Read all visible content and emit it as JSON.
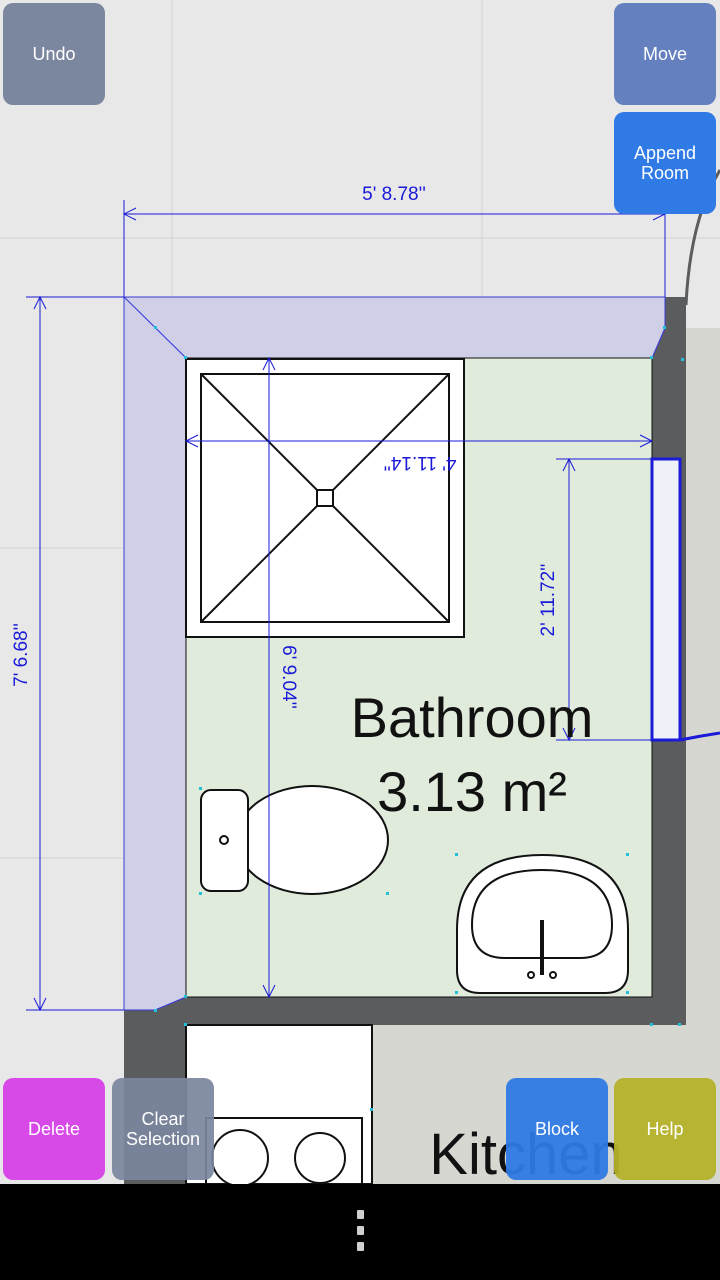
{
  "toolbar": {
    "undo_label": "Undo",
    "move_label": "Move",
    "append_room_label": "Append\nRoom",
    "delete_label": "Delete",
    "clear_selection_label": "Clear\nSelection",
    "block_label": "Block",
    "help_label": "Help"
  },
  "colors": {
    "undo": "#7b869f",
    "move": "#6480bf",
    "append_room": "#2f7ae5",
    "delete": "#d84ae8",
    "clear_selection": "#7b869f",
    "block": "#2f7ae5",
    "help": "#b5b22a",
    "dimension": "#1a1ad8",
    "floor": "#e0ebdc",
    "wall": "#5a5c5e"
  },
  "plan": {
    "room_name": "Bathroom",
    "room_area": "3.13 m²",
    "kitchen_label": "Kitchen",
    "dim_top": "5' 8.78''",
    "dim_left": "7' 6.68''",
    "dim_shower_width": "4' 11.14''",
    "dim_inner_height": "6' 9.04''",
    "dim_door": "2' 11.72''"
  },
  "navbar": {
    "menu_icon": "overflow-menu-icon"
  }
}
